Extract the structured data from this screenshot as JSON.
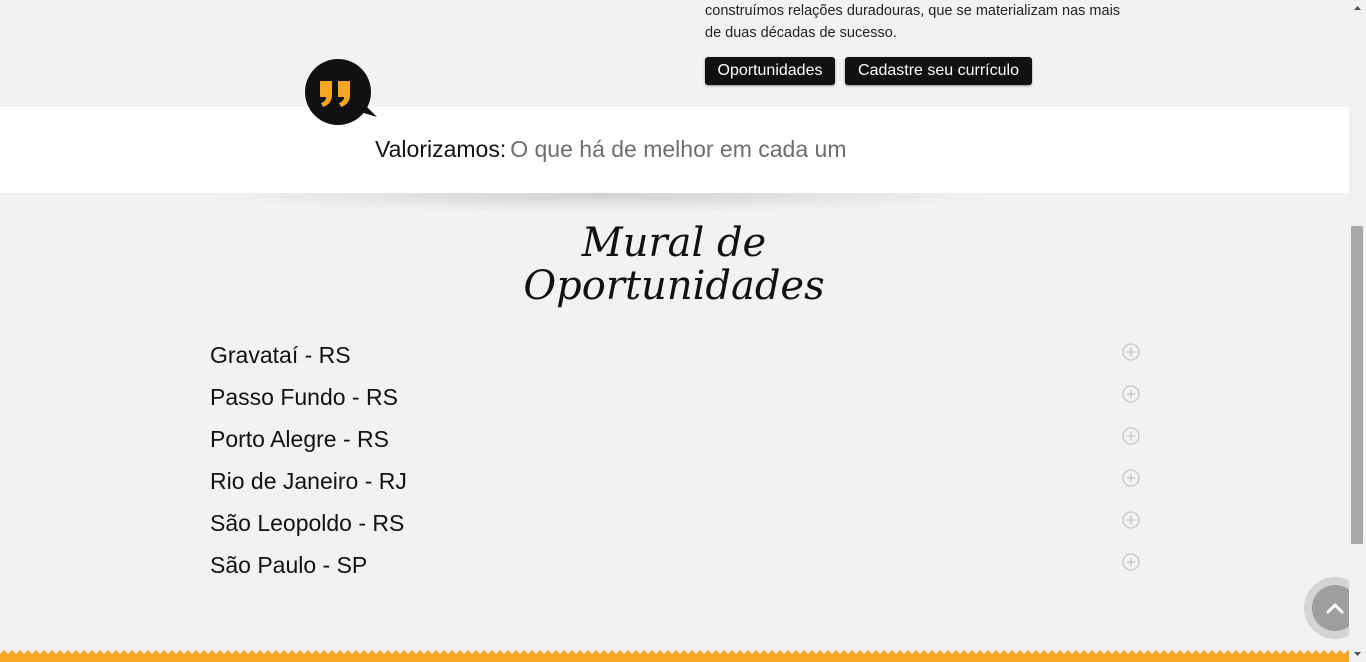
{
  "intro": {
    "text_line1": "construímos relações duradouras, que se materializam nas mais",
    "text_line2": "de duas décadas de sucesso."
  },
  "buttons": {
    "oportunidades": "Oportunidades",
    "cadastre": "Cadastre seu currículo"
  },
  "quote": {
    "icon": "quote-bubble-icon",
    "label": "Valorizamos:",
    "value": "O que há de melhor em cada um"
  },
  "mural": {
    "title_line1": "Mural de",
    "title_line2": "Oportunidades"
  },
  "cities": [
    {
      "label": "Gravataí - RS"
    },
    {
      "label": "Passo Fundo - RS"
    },
    {
      "label": "Porto Alegre - RS"
    },
    {
      "label": "Rio de Janeiro - RJ"
    },
    {
      "label": "São Leopoldo - RS"
    },
    {
      "label": "São Paulo - SP"
    }
  ],
  "colors": {
    "accent_orange": "#f5a623",
    "button_bg": "#111111",
    "band_bg": "#ffffff",
    "page_bg": "#f2f2f2"
  }
}
